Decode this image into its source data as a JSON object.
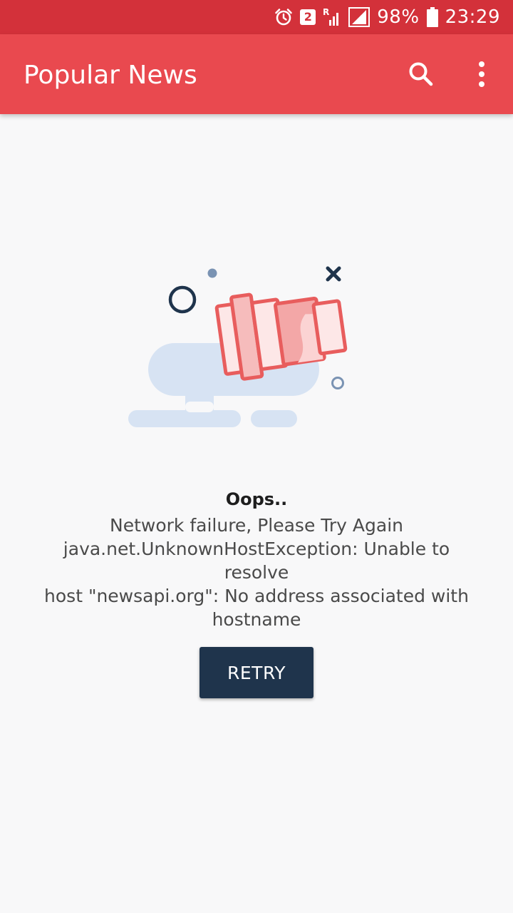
{
  "status_bar": {
    "sim_slot": "2",
    "roaming": "R",
    "battery_percent": "98%",
    "time": "23:29",
    "background_color": "#d3313a",
    "icons": [
      "alarm-icon",
      "sim-badge-icon",
      "signal-roaming-icon",
      "signal-icon",
      "battery-icon"
    ]
  },
  "app_bar": {
    "title": "Popular News",
    "background_color": "#e9494f",
    "actions": [
      "search-icon",
      "more-options-icon"
    ]
  },
  "illustration": {
    "subject": "broken-megaphone-icon",
    "colors": {
      "cloud": "#d7e3f3",
      "megaphone_stroke": "#e85d5d",
      "megaphone_fill": "#fde7e7",
      "ring": "#1f344c",
      "x_mark": "#1f344c",
      "dot": "#7a93b3"
    }
  },
  "error": {
    "title": "Oops..",
    "lines": [
      "Network failure, Please Try Again",
      "java.net.UnknownHostException: Unable to resolve",
      "host \"newsapi.org\": No address associated with",
      "hostname"
    ]
  },
  "retry_button": {
    "label": "RETRY",
    "background_color": "#1f344c"
  }
}
